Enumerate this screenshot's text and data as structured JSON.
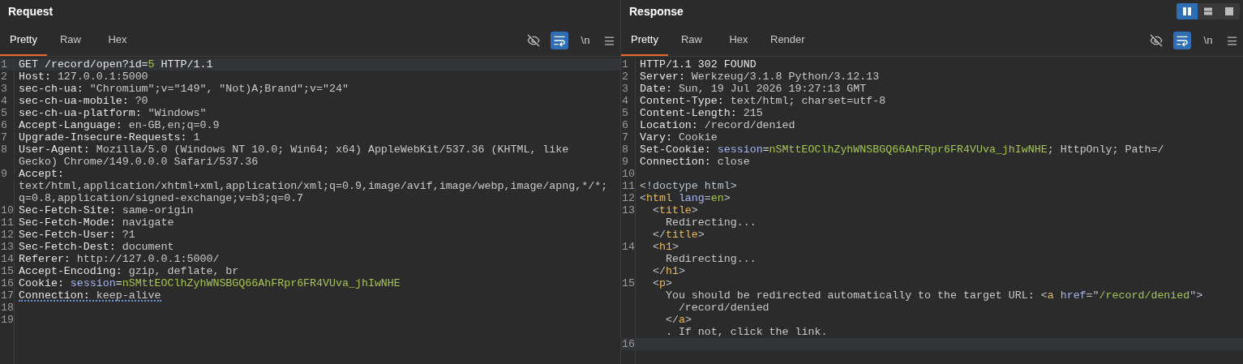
{
  "layout_toggle": [
    {
      "kind": "columns",
      "selected": true
    },
    {
      "kind": "rows",
      "selected": false
    },
    {
      "kind": "single",
      "selected": false
    }
  ],
  "panels": [
    {
      "title": "Request",
      "tabs": [
        {
          "label": "Pretty",
          "selected": true
        },
        {
          "label": "Raw",
          "selected": false
        },
        {
          "label": "Hex",
          "selected": false
        }
      ],
      "toolbar": {
        "hide_on": false,
        "wrap_on": true,
        "newline_label": "\\n"
      },
      "rows": [
        {
          "number": "1",
          "current": true,
          "underlined": false,
          "segments": [
            {
              "text": "GET /record/open?id=",
              "kind": "name"
            },
            {
              "text": "5",
              "kind": "value"
            },
            {
              "text": " HTTP/1.1",
              "kind": "name"
            }
          ]
        },
        {
          "number": "2",
          "current": false,
          "underlined": false,
          "segments": [
            {
              "text": "Host:",
              "kind": "name"
            },
            {
              "text": " 127.0.0.1:5000",
              "kind": "plain"
            }
          ]
        },
        {
          "number": "3",
          "current": false,
          "underlined": false,
          "segments": [
            {
              "text": "sec-ch-ua:",
              "kind": "name"
            },
            {
              "text": " \"Chromium\";v=\"149\", \"Not)A;Brand\";v=\"24\"",
              "kind": "plain"
            }
          ]
        },
        {
          "number": "4",
          "current": false,
          "underlined": false,
          "segments": [
            {
              "text": "sec-ch-ua-mobile:",
              "kind": "name"
            },
            {
              "text": " ?0",
              "kind": "plain"
            }
          ]
        },
        {
          "number": "5",
          "current": false,
          "underlined": false,
          "segments": [
            {
              "text": "sec-ch-ua-platform:",
              "kind": "name"
            },
            {
              "text": " \"Windows\"",
              "kind": "plain"
            }
          ]
        },
        {
          "number": "6",
          "current": false,
          "underlined": false,
          "segments": [
            {
              "text": "Accept-Language:",
              "kind": "name"
            },
            {
              "text": " en-GB,en;q=0.9",
              "kind": "plain"
            }
          ]
        },
        {
          "number": "7",
          "current": false,
          "underlined": false,
          "segments": [
            {
              "text": "Upgrade-Insecure-Requests:",
              "kind": "name"
            },
            {
              "text": " 1",
              "kind": "plain"
            }
          ]
        },
        {
          "number": "8",
          "current": false,
          "underlined": false,
          "segments": [
            {
              "text": "User-Agent:",
              "kind": "name"
            },
            {
              "text": " Mozilla/5.0 (Windows NT 10.0; Win64; x64) AppleWebKit/537.36 (KHTML, like",
              "kind": "plain"
            }
          ]
        },
        {
          "current": false,
          "underlined": false,
          "segments": [
            {
              "text": "Gecko) Chrome/149.0.0.0 Safari/537.36",
              "kind": "plain"
            }
          ]
        },
        {
          "number": "9",
          "current": false,
          "underlined": false,
          "segments": [
            {
              "text": "Accept:",
              "kind": "name"
            }
          ]
        },
        {
          "current": false,
          "underlined": false,
          "segments": [
            {
              "text": "text/html,application/xhtml+xml,application/xml;q=0.9,image/avif,image/webp,image/apng,*/*;",
              "kind": "plain"
            }
          ]
        },
        {
          "current": false,
          "underlined": false,
          "segments": [
            {
              "text": "q=0.8,application/signed-exchange;v=b3;q=0.7",
              "kind": "plain"
            }
          ]
        },
        {
          "number": "10",
          "current": false,
          "underlined": false,
          "segments": [
            {
              "text": "Sec-Fetch-Site:",
              "kind": "name"
            },
            {
              "text": " same-origin",
              "kind": "plain"
            }
          ]
        },
        {
          "number": "11",
          "current": false,
          "underlined": false,
          "segments": [
            {
              "text": "Sec-Fetch-Mode:",
              "kind": "name"
            },
            {
              "text": " navigate",
              "kind": "plain"
            }
          ]
        },
        {
          "number": "12",
          "current": false,
          "underlined": false,
          "segments": [
            {
              "text": "Sec-Fetch-User:",
              "kind": "name"
            },
            {
              "text": " ?1",
              "kind": "plain"
            }
          ]
        },
        {
          "number": "13",
          "current": false,
          "underlined": false,
          "segments": [
            {
              "text": "Sec-Fetch-Dest:",
              "kind": "name"
            },
            {
              "text": " document",
              "kind": "plain"
            }
          ]
        },
        {
          "number": "14",
          "current": false,
          "underlined": false,
          "segments": [
            {
              "text": "Referer:",
              "kind": "name"
            },
            {
              "text": " http://127.0.0.1:5000/",
              "kind": "plain"
            }
          ]
        },
        {
          "number": "15",
          "current": false,
          "underlined": false,
          "segments": [
            {
              "text": "Accept-Encoding:",
              "kind": "name"
            },
            {
              "text": " gzip, deflate, br",
              "kind": "plain"
            }
          ]
        },
        {
          "number": "16",
          "current": false,
          "underlined": false,
          "segments": [
            {
              "text": "Cookie:",
              "kind": "name"
            },
            {
              "text": " session",
              "kind": "attr"
            },
            {
              "text": "=",
              "kind": "name"
            },
            {
              "text": "nSMttEOClhZyhWNSBGQ66AhFRpr6FR4VUva_jhIwNHE",
              "kind": "value"
            }
          ]
        },
        {
          "number": "17",
          "current": false,
          "underlined": true,
          "segments": [
            {
              "text": "Connection:",
              "kind": "name"
            },
            {
              "text": " keep-alive",
              "kind": "plain"
            }
          ]
        },
        {
          "number": "18",
          "current": false,
          "underlined": false,
          "segments": []
        },
        {
          "number": "19",
          "current": false,
          "underlined": false,
          "segments": []
        }
      ]
    },
    {
      "title": "Response",
      "tabs": [
        {
          "label": "Pretty",
          "selected": true
        },
        {
          "label": "Raw",
          "selected": false
        },
        {
          "label": "Hex",
          "selected": false
        },
        {
          "label": "Render",
          "selected": false
        }
      ],
      "toolbar": {
        "hide_on": false,
        "wrap_on": true,
        "newline_label": "\\n"
      },
      "rows": [
        {
          "number": "1",
          "current": false,
          "underlined": false,
          "segments": [
            {
              "text": "HTTP/1.1 302 FOUND",
              "kind": "name"
            }
          ]
        },
        {
          "number": "2",
          "current": false,
          "underlined": false,
          "segments": [
            {
              "text": "Server:",
              "kind": "name"
            },
            {
              "text": " Werkzeug/3.1.8 Python/3.12.13",
              "kind": "plain"
            }
          ]
        },
        {
          "number": "3",
          "current": false,
          "underlined": false,
          "segments": [
            {
              "text": "Date:",
              "kind": "name"
            },
            {
              "text": " Sun, 19 Jul 2026 19:27:13 GMT",
              "kind": "plain"
            }
          ]
        },
        {
          "number": "4",
          "current": false,
          "underlined": false,
          "segments": [
            {
              "text": "Content-Type:",
              "kind": "name"
            },
            {
              "text": " text/html; charset=utf-8",
              "kind": "plain"
            }
          ]
        },
        {
          "number": "5",
          "current": false,
          "underlined": false,
          "segments": [
            {
              "text": "Content-Length:",
              "kind": "name"
            },
            {
              "text": " 215",
              "kind": "plain"
            }
          ]
        },
        {
          "number": "6",
          "current": false,
          "underlined": false,
          "segments": [
            {
              "text": "Location:",
              "kind": "name"
            },
            {
              "text": " /record/denied",
              "kind": "plain"
            }
          ]
        },
        {
          "number": "7",
          "current": false,
          "underlined": false,
          "segments": [
            {
              "text": "Vary:",
              "kind": "name"
            },
            {
              "text": " Cookie",
              "kind": "plain"
            }
          ]
        },
        {
          "number": "8",
          "current": false,
          "underlined": false,
          "segments": [
            {
              "text": "Set-Cookie:",
              "kind": "name"
            },
            {
              "text": " session",
              "kind": "attr"
            },
            {
              "text": "=",
              "kind": "name"
            },
            {
              "text": "nSMttEOClhZyhWNSBGQ66AhFRpr6FR4VUva_jhIwNHE",
              "kind": "value"
            },
            {
              "text": "; HttpOnly; Path=/",
              "kind": "plain"
            }
          ]
        },
        {
          "number": "9",
          "current": false,
          "underlined": false,
          "segments": [
            {
              "text": "Connection:",
              "kind": "name"
            },
            {
              "text": " close",
              "kind": "plain"
            }
          ]
        },
        {
          "number": "10",
          "current": false,
          "underlined": false,
          "segments": []
        },
        {
          "number": "11",
          "current": false,
          "underlined": false,
          "segments": [
            {
              "text": "<!doctype html>",
              "kind": "punct"
            }
          ]
        },
        {
          "number": "12",
          "current": false,
          "underlined": false,
          "segments": [
            {
              "text": "<",
              "kind": "punct"
            },
            {
              "text": "html",
              "kind": "tag"
            },
            {
              "text": " lang",
              "kind": "attr"
            },
            {
              "text": "=",
              "kind": "punct"
            },
            {
              "text": "en",
              "kind": "value"
            },
            {
              "text": ">",
              "kind": "punct"
            }
          ]
        },
        {
          "number": "13",
          "current": false,
          "underlined": false,
          "segments": [
            {
              "text": "  <",
              "kind": "punct"
            },
            {
              "text": "title",
              "kind": "tag"
            },
            {
              "text": ">",
              "kind": "punct"
            }
          ]
        },
        {
          "current": false,
          "underlined": false,
          "segments": [
            {
              "text": "    Redirecting...",
              "kind": "plain"
            }
          ]
        },
        {
          "current": false,
          "underlined": false,
          "segments": [
            {
              "text": "  </",
              "kind": "punct"
            },
            {
              "text": "title",
              "kind": "tag"
            },
            {
              "text": ">",
              "kind": "punct"
            }
          ]
        },
        {
          "number": "14",
          "current": false,
          "underlined": false,
          "segments": [
            {
              "text": "  <",
              "kind": "punct"
            },
            {
              "text": "h1",
              "kind": "tag"
            },
            {
              "text": ">",
              "kind": "punct"
            }
          ]
        },
        {
          "current": false,
          "underlined": false,
          "segments": [
            {
              "text": "    Redirecting...",
              "kind": "plain"
            }
          ]
        },
        {
          "current": false,
          "underlined": false,
          "segments": [
            {
              "text": "  </",
              "kind": "punct"
            },
            {
              "text": "h1",
              "kind": "tag"
            },
            {
              "text": ">",
              "kind": "punct"
            }
          ]
        },
        {
          "number": "15",
          "current": false,
          "underlined": false,
          "segments": [
            {
              "text": "  <",
              "kind": "punct"
            },
            {
              "text": "p",
              "kind": "tag"
            },
            {
              "text": ">",
              "kind": "punct"
            }
          ]
        },
        {
          "current": false,
          "underlined": false,
          "segments": [
            {
              "text": "    You should be redirected automatically to the target URL: ",
              "kind": "plain"
            },
            {
              "text": "<",
              "kind": "punct"
            },
            {
              "text": "a",
              "kind": "tag"
            },
            {
              "text": " href",
              "kind": "attr"
            },
            {
              "text": "=\"",
              "kind": "punct"
            },
            {
              "text": "/record/denied",
              "kind": "value"
            },
            {
              "text": "\">",
              "kind": "punct"
            }
          ]
        },
        {
          "current": false,
          "underlined": false,
          "segments": [
            {
              "text": "      /record/denied",
              "kind": "plain"
            }
          ]
        },
        {
          "current": false,
          "underlined": false,
          "segments": [
            {
              "text": "    </",
              "kind": "punct"
            },
            {
              "text": "a",
              "kind": "tag"
            },
            {
              "text": ">",
              "kind": "punct"
            }
          ]
        },
        {
          "current": false,
          "underlined": false,
          "segments": [
            {
              "text": "    . If not, click the link.",
              "kind": "plain"
            }
          ]
        },
        {
          "number": "16",
          "current": true,
          "underlined": false,
          "segments": []
        }
      ]
    }
  ]
}
